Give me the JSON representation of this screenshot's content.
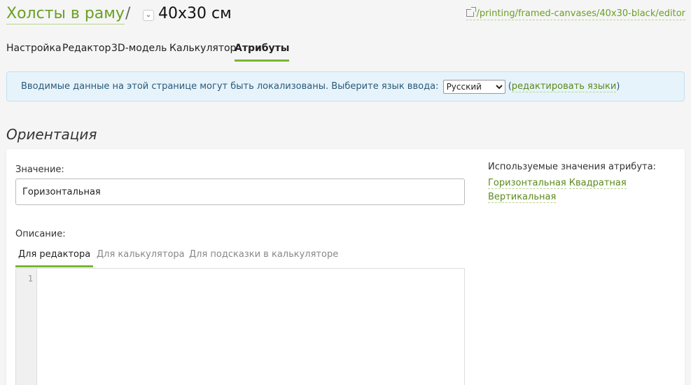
{
  "header": {
    "root_crumb": "Холсты в раму",
    "separator": "/",
    "toggle": "⌄",
    "current": "40x30 см",
    "url": "/printing/framed-canvases/40x30-black/editor"
  },
  "tabs": [
    {
      "label": "Настройка"
    },
    {
      "label": "Редактор"
    },
    {
      "label": "3D-модель"
    },
    {
      "label": "Калькулятор"
    },
    {
      "label": "Атрибуты",
      "active": true
    }
  ],
  "banner": {
    "text": "Вводимые данные на этой странице могут быть локализованы. Выберите язык ввода:",
    "language_selected": "Русский",
    "paren_open": "(",
    "edit_link": "редактировать языки",
    "paren_close": ")"
  },
  "section": {
    "title": "Ориентация"
  },
  "form": {
    "value_label": "Значение:",
    "value": "Горизонтальная",
    "description_label": "Описание:",
    "used_values_title": "Используемые значения атрибута:",
    "used_values": [
      "Горизонтальная",
      "Квадратная",
      "Вертикальная"
    ],
    "subtabs": [
      {
        "label": "Для редактора",
        "active": true
      },
      {
        "label": "Для калькулятора"
      },
      {
        "label": "Для подсказки в калькуляторе"
      }
    ],
    "editor_line": "1"
  },
  "colors": {
    "accent": "#7ab533",
    "link": "#6aa022",
    "banner_bg": "#e7f3fb"
  }
}
